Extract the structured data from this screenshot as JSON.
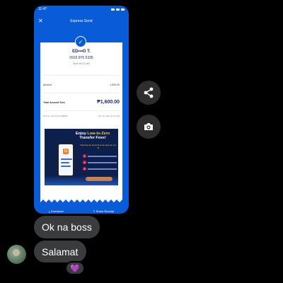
{
  "status_bar": {
    "time": "11:47"
  },
  "receipt": {
    "title": "Express Send",
    "recipient_name": "ED•••O T.",
    "recipient_number": "0916 876 5335",
    "sent_via": "Sent via GCash",
    "amount_label": "Amount",
    "amount_value": "1,600.00",
    "total_label": "Total Amount Sent",
    "total_value": "₱1,600.00",
    "ref_label": "Ref No. 6014 541 008886",
    "ref_date": "Jun 15, 2024 11:47 AM",
    "download_label": "Download",
    "share_label": "Share Receipt"
  },
  "promo": {
    "title_line1": "Enjoy ",
    "title_highlight": "Low-to-Zero",
    "title_line2": "Transfer Fees!",
    "subtitle": "Opening an account is as easy as 1-2-3!",
    "logo_letter": "U"
  },
  "messages": [
    {
      "text": "Ok na boss"
    },
    {
      "text": "Salamat"
    }
  ],
  "reaction": {
    "emoji": "💜"
  },
  "colors": {
    "gcash_blue": "#0a5bd8",
    "bubble": "#3a3b3c",
    "background": "#000000"
  },
  "icons": {
    "share": "share-icon",
    "camera": "camera-icon"
  }
}
